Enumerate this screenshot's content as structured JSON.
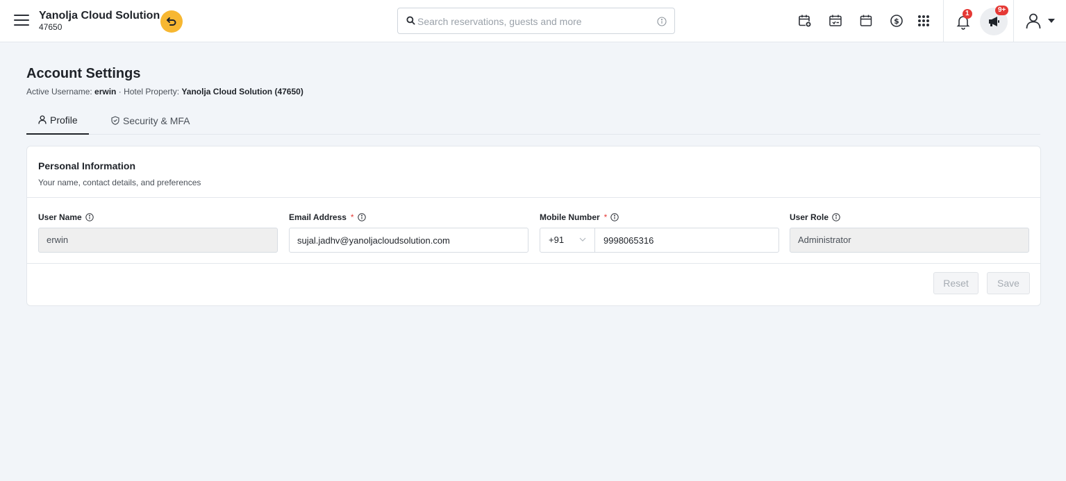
{
  "header": {
    "brand_name": "Yanolja Cloud Solution",
    "brand_id": "47650",
    "search_placeholder": "Search reservations, guests and more",
    "notification_count": "1",
    "announcement_count": "9+"
  },
  "icons": {
    "menu": "hamburger-icon",
    "back": "undo-arrow-icon",
    "search": "search-icon",
    "info": "info-icon",
    "toolbar": [
      "calendar-add-icon",
      "calendar-check-icon",
      "calendar-icon",
      "dollar-icon",
      "apps-grid-icon"
    ],
    "bell": "bell-icon",
    "megaphone": "megaphone-icon",
    "user": "user-icon"
  },
  "page": {
    "title": "Account Settings",
    "active_username_label": "Active Username:",
    "active_username": "erwin",
    "separator": " · ",
    "hotel_property_label": "Hotel Property:",
    "hotel_property": "Yanolja Cloud Solution (47650)"
  },
  "tabs": [
    {
      "label": "Profile",
      "active": true
    },
    {
      "label": "Security & MFA",
      "active": false
    }
  ],
  "card": {
    "title": "Personal Information",
    "subtitle": "Your name, contact details, and preferences",
    "fields": {
      "username": {
        "label": "User Name",
        "value": "erwin"
      },
      "email": {
        "label": "Email Address",
        "required_mark": "*",
        "value": "sujal.jadhv@yanoljacloudsolution.com"
      },
      "mobile": {
        "label": "Mobile Number",
        "required_mark": "*",
        "code": "+91",
        "value": "9998065316"
      },
      "role": {
        "label": "User Role",
        "value": "Administrator"
      }
    },
    "reset_label": "Reset",
    "save_label": "Save"
  },
  "colors": {
    "accent_back_button": "#f7b731",
    "badge": "#e53935",
    "background": "#f2f5f9"
  }
}
